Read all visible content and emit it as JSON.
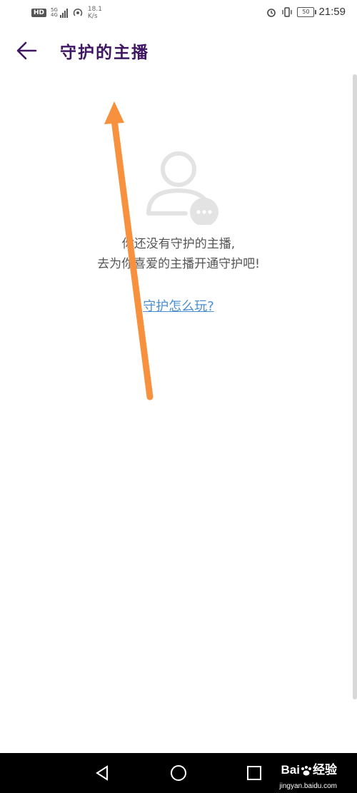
{
  "status_bar": {
    "hd": "HD",
    "sig_top": "5G",
    "sig_bottom": "4G",
    "speed_value": "18.1",
    "speed_unit": "K/s",
    "battery": "50",
    "time": "21:59"
  },
  "header": {
    "title": "守护的主播"
  },
  "empty_state": {
    "line1": "你还没有守护的主播,",
    "line2": "去为你喜爱的主播开通守护吧!",
    "link": "守护怎么玩?"
  },
  "watermark": {
    "brand": "Bai",
    "brand2": "经验",
    "url": "jingyan.baidu.com"
  },
  "colors": {
    "title": "#3f1663",
    "link": "#4a8fd4",
    "arrow": "#f7913d"
  }
}
